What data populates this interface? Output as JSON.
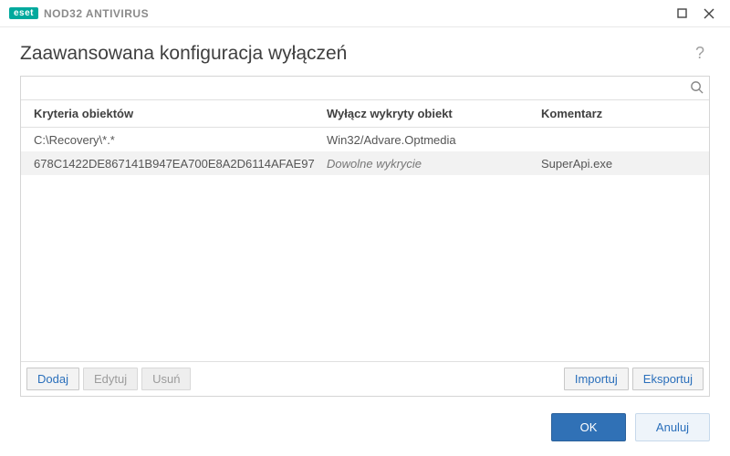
{
  "titlebar": {
    "brand_badge": "eset",
    "product": "NOD32 ANTIVIRUS"
  },
  "header": {
    "title": "Zaawansowana konfiguracja wyłączeń",
    "help_symbol": "?"
  },
  "search": {
    "placeholder": ""
  },
  "table": {
    "columns": {
      "criteria": "Kryteria obiektów",
      "detection": "Wyłącz wykryty obiekt",
      "comment": "Komentarz"
    },
    "rows": [
      {
        "criteria": "C:\\Recovery\\*.*",
        "detection": "Win32/Advare.Optmedia",
        "detection_italic": false,
        "comment": ""
      },
      {
        "criteria": "678C1422DE867141B947EA700E8A2D6114AFAE97",
        "detection": "Dowolne wykrycie",
        "detection_italic": true,
        "comment": "SuperApi.exe"
      }
    ]
  },
  "toolbar": {
    "add": "Dodaj",
    "edit": "Edytuj",
    "remove": "Usuń",
    "import": "Importuj",
    "export": "Eksportuj"
  },
  "footer": {
    "ok": "OK",
    "cancel": "Anuluj"
  }
}
